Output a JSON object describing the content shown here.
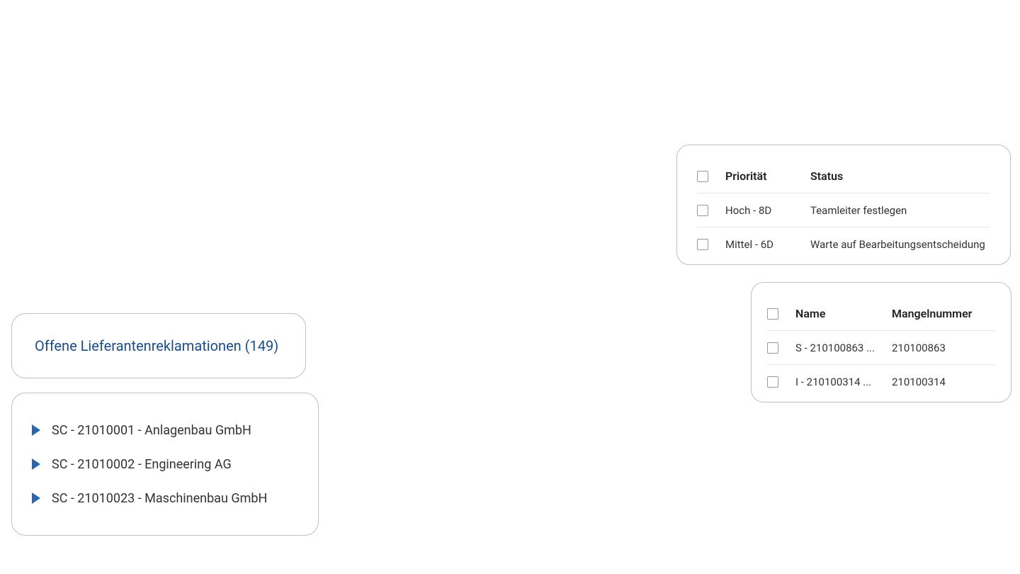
{
  "title": "Offene Lieferantenreklamationen (149)",
  "tree": {
    "items": [
      {
        "label": "SC - 21010001 - Anlagenbau GmbH"
      },
      {
        "label": "SC - 21010002 - Engineering AG"
      },
      {
        "label": "SC - 21010023 - Maschinenbau GmbH"
      }
    ]
  },
  "priority_table": {
    "headers": {
      "priority": "Priorität",
      "status": "Status"
    },
    "rows": [
      {
        "priority": "Hoch - 8D",
        "status": "Teamleiter festlegen"
      },
      {
        "priority": "Mittel - 6D",
        "status": "Warte auf Bearbeitungsentscheidung"
      }
    ]
  },
  "name_table": {
    "headers": {
      "name": "Name",
      "number": "Mangelnummer"
    },
    "rows": [
      {
        "name": "S - 210100863 ...",
        "number": "210100863"
      },
      {
        "name": "I - 210100314 ...",
        "number": "210100314"
      }
    ]
  }
}
